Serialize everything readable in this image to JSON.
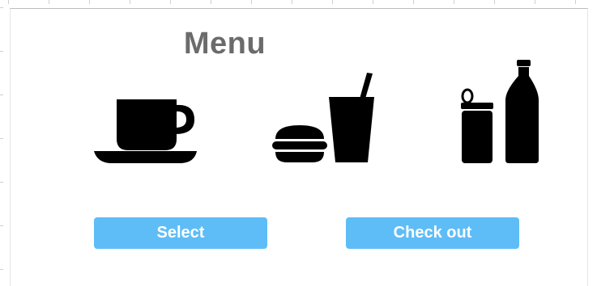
{
  "menu": {
    "title": "Menu"
  },
  "icons": [
    {
      "name": "coffee-cup-icon"
    },
    {
      "name": "burger-drink-icon"
    },
    {
      "name": "can-bottle-icon"
    }
  ],
  "buttons": {
    "select_label": "Select",
    "checkout_label": "Check out"
  },
  "colors": {
    "button_bg": "#5ebdf7",
    "button_text": "#ffffff",
    "title_text": "#6b6b6b",
    "icon_fill": "#000000"
  }
}
